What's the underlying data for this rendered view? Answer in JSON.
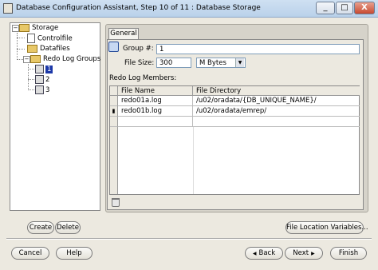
{
  "window": {
    "title": "Database Configuration Assistant, Step 10 of 11 : Database Storage",
    "controls": {
      "minimize": "_",
      "maximize": "□",
      "close": "X"
    }
  },
  "tree": {
    "items": [
      {
        "label": "Storage",
        "icon": "folder-icon"
      },
      {
        "label": "Controlfile",
        "icon": "document-icon"
      },
      {
        "label": "Datafiles",
        "icon": "folder-icon"
      },
      {
        "label": "Redo Log Groups",
        "icon": "folder-icon"
      },
      {
        "label": "1",
        "icon": "redo-log-icon",
        "selected": true
      },
      {
        "label": "2",
        "icon": "redo-log-icon"
      },
      {
        "label": "3",
        "icon": "redo-log-icon"
      }
    ]
  },
  "tabs": [
    {
      "label": "General",
      "active": true
    }
  ],
  "form": {
    "group_label": "Group #:",
    "group_value": "1",
    "file_size_label": "File Size:",
    "file_size_value": "300",
    "unit_value": "M Bytes",
    "members_label": "Redo Log Members:"
  },
  "table": {
    "headers": [
      "File Name",
      "File Directory"
    ],
    "rows": [
      {
        "marker": "",
        "file_name": "redo01a.log",
        "directory": "/u02/oradata/{DB_UNIQUE_NAME}/"
      },
      {
        "marker": "▮",
        "file_name": "redo01b.log",
        "directory": "/u02/oradata/emrep/"
      },
      {
        "marker": "",
        "file_name": "",
        "directory": ""
      }
    ]
  },
  "buttons": {
    "create": "Create",
    "delete": "Delete",
    "file_location": "File Location Variables...",
    "cancel": "Cancel",
    "help": "Help",
    "back": "Back",
    "back_arrow": "◀",
    "next": "Next",
    "next_arrow": "▶",
    "finish": "Finish"
  }
}
